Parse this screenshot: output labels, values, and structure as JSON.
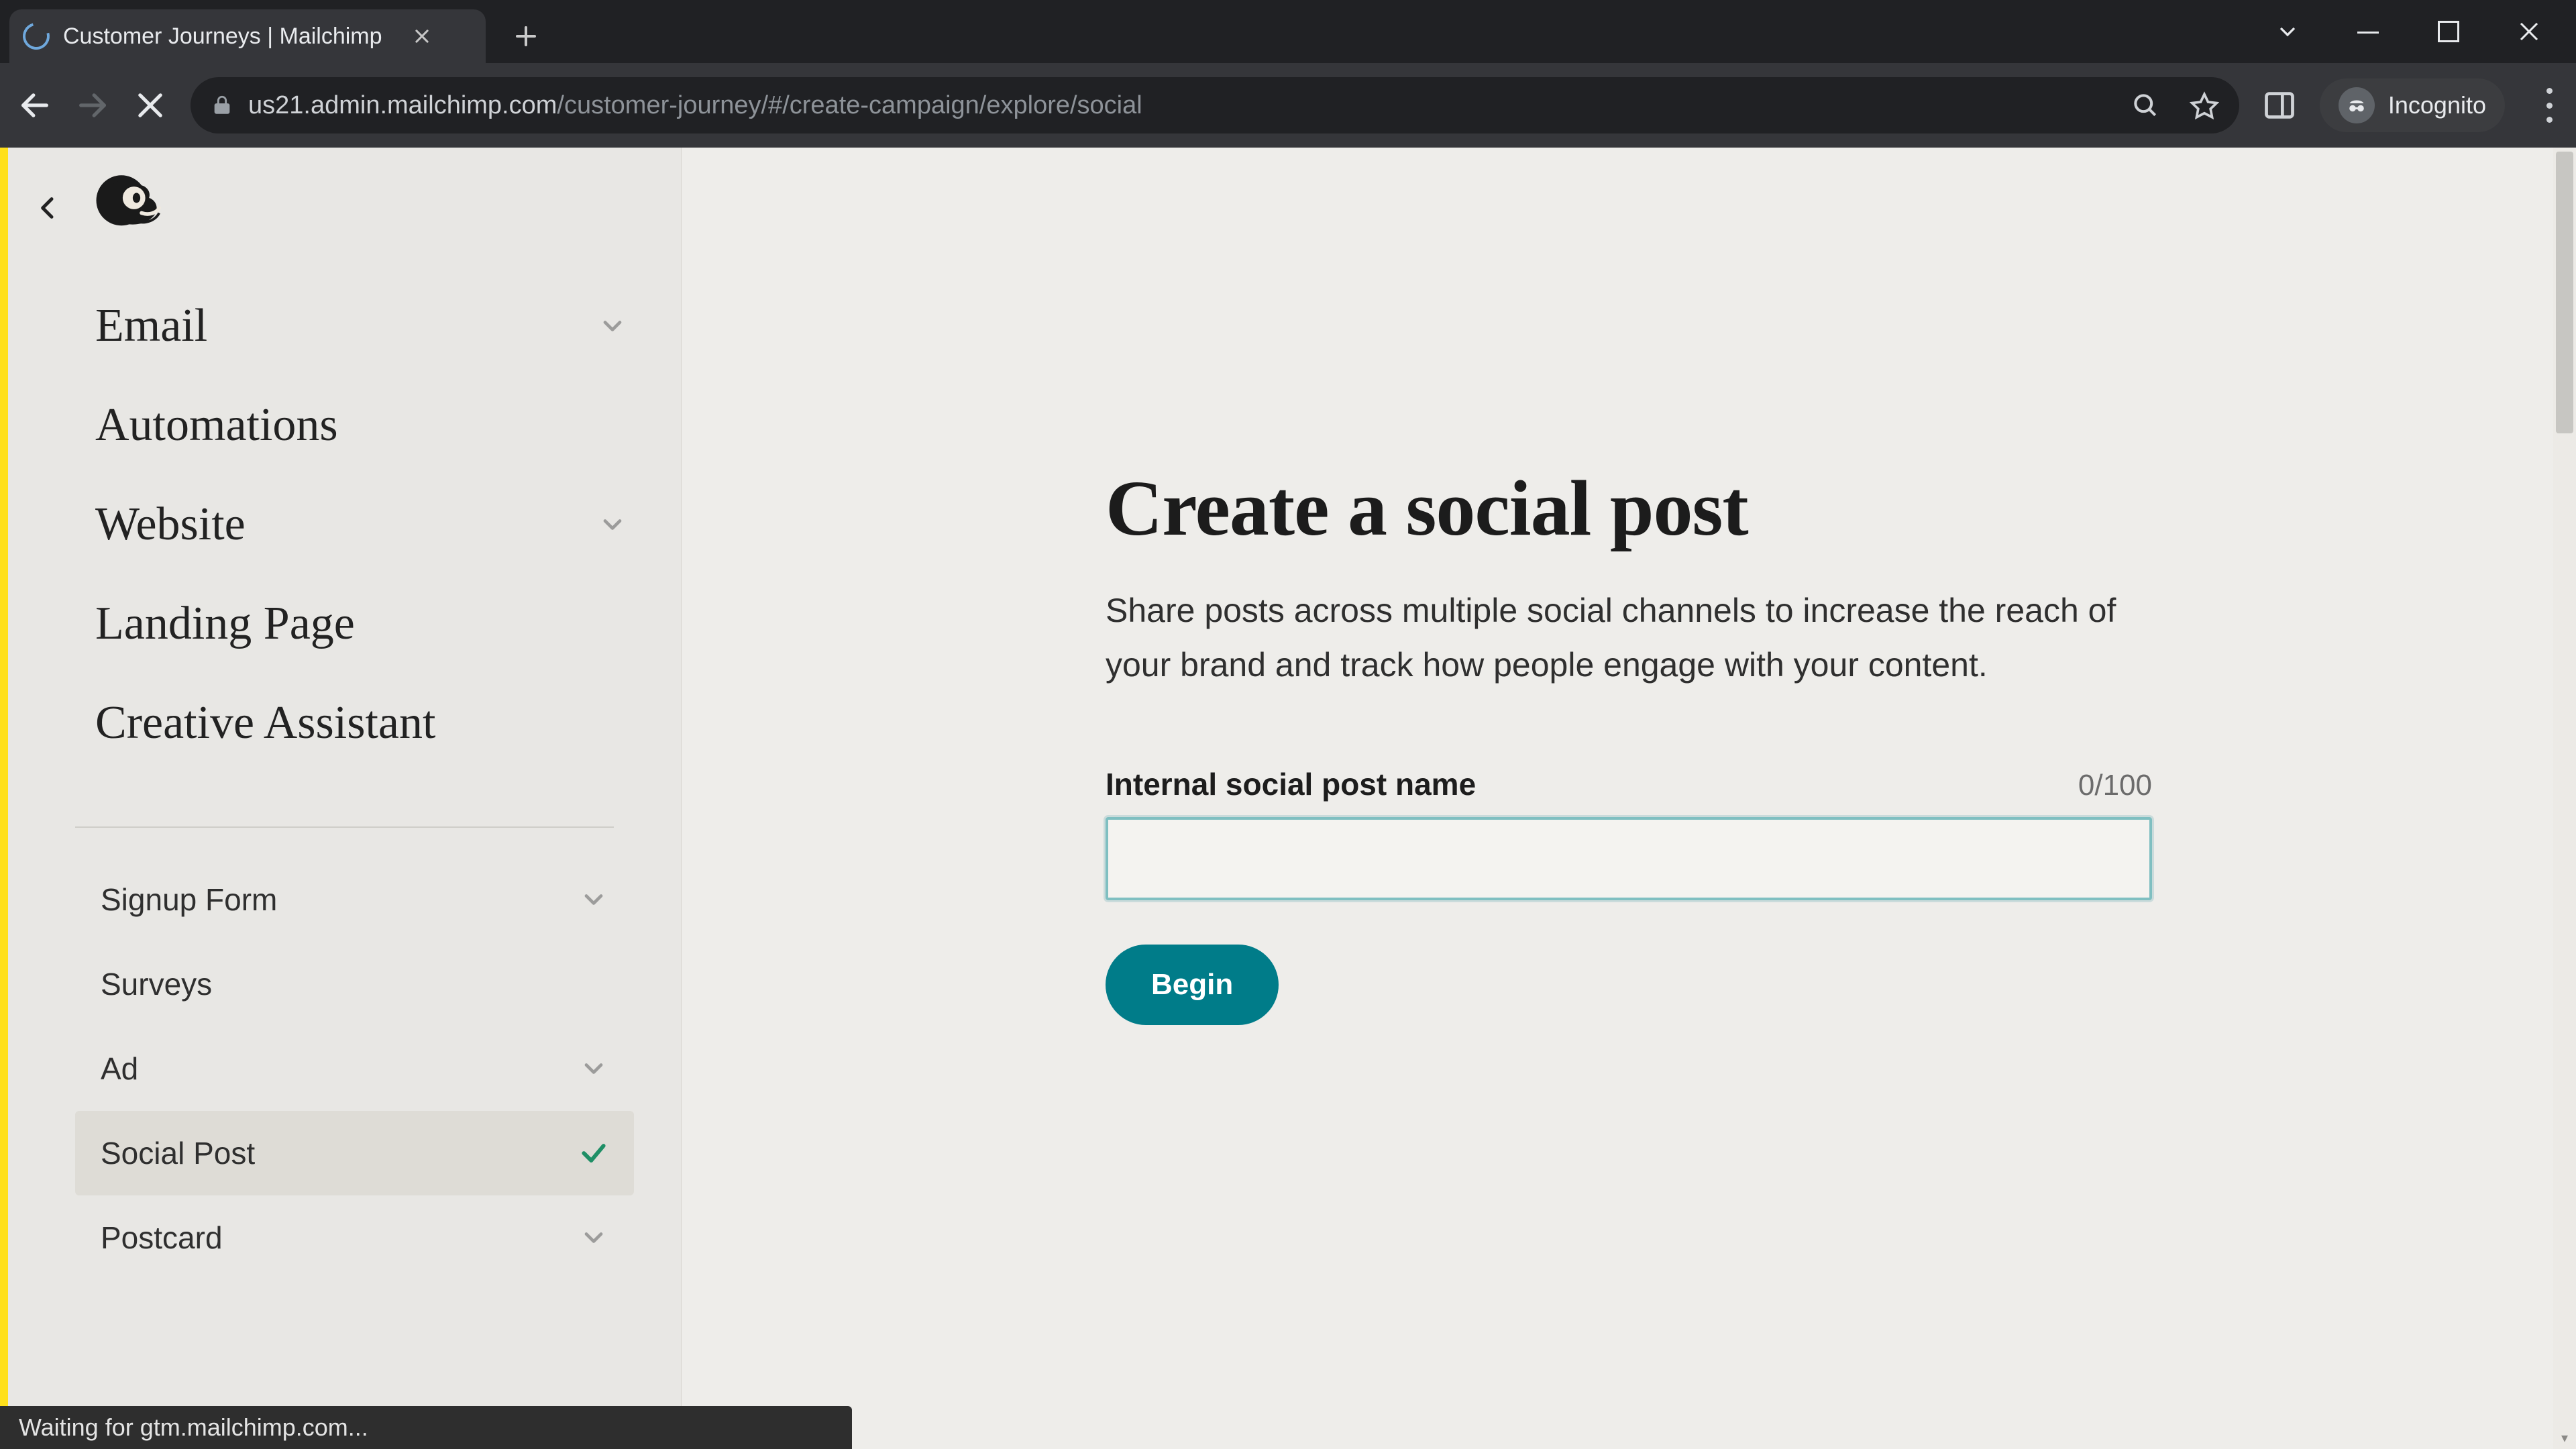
{
  "browser": {
    "tab_title": "Customer Journeys | Mailchimp",
    "url_host": "us21.admin.mailchimp.com",
    "url_path": "/customer-journey/#/create-campaign/explore/social",
    "incognito_label": "Incognito",
    "status_text": "Waiting for gtm.mailchimp.com..."
  },
  "sidebar": {
    "primary": [
      {
        "label": "Email",
        "expandable": true
      },
      {
        "label": "Automations",
        "expandable": false
      },
      {
        "label": "Website",
        "expandable": true
      },
      {
        "label": "Landing Page",
        "expandable": false
      },
      {
        "label": "Creative Assistant",
        "expandable": false
      }
    ],
    "secondary": [
      {
        "label": "Signup Form",
        "expandable": true,
        "selected": false
      },
      {
        "label": "Surveys",
        "expandable": false,
        "selected": false
      },
      {
        "label": "Ad",
        "expandable": true,
        "selected": false
      },
      {
        "label": "Social Post",
        "expandable": false,
        "selected": true
      },
      {
        "label": "Postcard",
        "expandable": true,
        "selected": false
      }
    ]
  },
  "main": {
    "heading": "Create a social post",
    "description": "Share posts across multiple social channels to increase the reach of your brand and track how people engage with your content.",
    "field_label": "Internal social post name",
    "char_count": "0/100",
    "input_value": "",
    "begin_label": "Begin"
  }
}
